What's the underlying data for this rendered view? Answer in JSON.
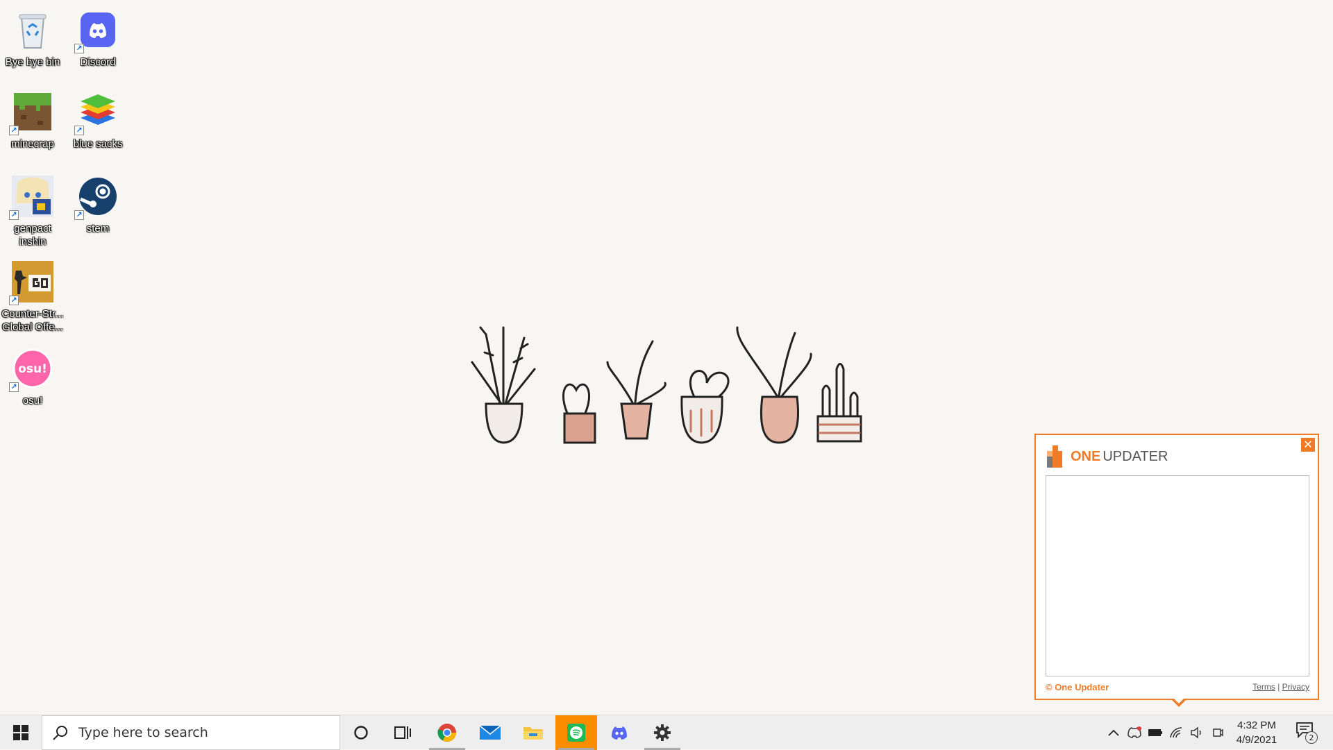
{
  "desktop": {
    "icons": [
      {
        "label": "Bye bye bin",
        "icon": "recycle-bin-icon"
      },
      {
        "label": "Discord",
        "icon": "discord-icon"
      },
      {
        "label": "minecrap",
        "icon": "minecraft-icon"
      },
      {
        "label": "blue sacks",
        "icon": "bluestacks-icon"
      },
      {
        "label": "genpact inshin",
        "icon": "genshin-icon"
      },
      {
        "label": "stem",
        "icon": "steam-icon"
      },
      {
        "label": "Counter-Str... Global Offe...",
        "icon": "csgo-icon"
      },
      {
        "label": "osu!",
        "icon": "osu-icon"
      }
    ]
  },
  "updater": {
    "brand_one": "ONE",
    "brand_updater": "UPDATER",
    "close_glyph": "✕",
    "copyright": "© One Updater",
    "terms": "Terms",
    "separator": "|",
    "privacy": "Privacy",
    "accent": "#f07b26"
  },
  "taskbar": {
    "search_placeholder": "Type here to search",
    "pinned": [
      "chrome-icon",
      "mail-icon",
      "file-explorer-icon",
      "spotify-icon",
      "discord-icon",
      "settings-icon"
    ],
    "clock_time": "4:32 PM",
    "clock_date": "4/9/2021",
    "notification_count": "2",
    "active_color": "#fb8c00"
  }
}
